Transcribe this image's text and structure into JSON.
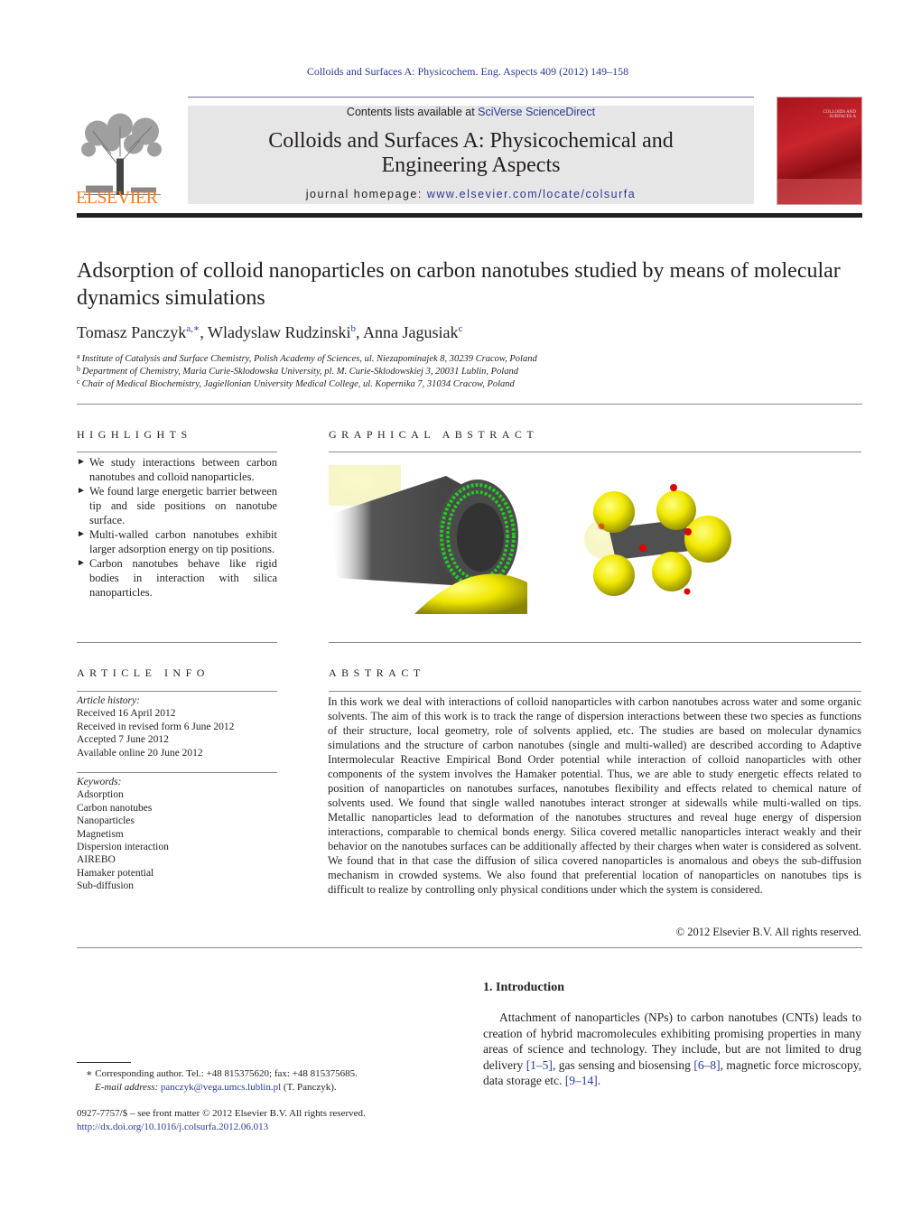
{
  "header": {
    "running_head": "Colloids and Surfaces A: Physicochem. Eng. Aspects 409 (2012) 149–158",
    "contents_prefix": "Contents lists available at ",
    "contents_link": "SciVerse ScienceDirect",
    "journal_title_line1": "Colloids and Surfaces A: Physicochemical and",
    "journal_title_line2": "Engineering Aspects",
    "homepage_prefix": "journal homepage: ",
    "homepage_link": "www.elsevier.com/locate/colsurfa",
    "publisher_logo_text": "ELSEVIER",
    "cover_title": "COLLOIDS AND SURFACES A"
  },
  "article": {
    "title": "Adsorption of colloid nanoparticles on carbon nanotubes studied by means of molecular dynamics simulations",
    "authors": [
      {
        "name": "Tomasz Panczyk",
        "sup": "a,∗"
      },
      {
        "name": "Wladyslaw Rudzinski",
        "sup": "b"
      },
      {
        "name": "Anna Jagusiak",
        "sup": "c"
      }
    ],
    "affiliations": [
      {
        "mark": "a",
        "text": "Institute of Catalysis and Surface Chemistry, Polish Academy of Sciences, ul. Niezapominajek 8, 30239 Cracow, Poland"
      },
      {
        "mark": "b",
        "text": "Department of Chemistry, Maria Curie-Sklodowska University, pl. M. Curie-Sklodowskiej 3, 20031 Lublin, Poland"
      },
      {
        "mark": "c",
        "text": "Chair of Medical Biochemistry, Jagiellonian University Medical College, ul. Kopernika 7, 31034 Cracow, Poland"
      }
    ]
  },
  "highlights": {
    "heading": "HIGHLIGHTS",
    "items": [
      "We study interactions between carbon nanotubes and colloid nanoparticles.",
      "We found large energetic barrier between tip and side positions on nanotube surface.",
      "Multi-walled carbon nanotubes exhibit larger adsorption energy on tip positions.",
      "Carbon nanotubes behave like rigid bodies in interaction with silica nanoparticles."
    ]
  },
  "graphical_abstract": {
    "heading": "GRAPHICAL ABSTRACT"
  },
  "article_info": {
    "heading": "ARTICLE INFO",
    "history_label": "Article history:",
    "history": [
      "Received 16 April 2012",
      "Received in revised form 6 June 2012",
      "Accepted 7 June 2012",
      "Available online 20 June 2012"
    ],
    "keywords_label": "Keywords:",
    "keywords": [
      "Adsorption",
      "Carbon nanotubes",
      "Nanoparticles",
      "Magnetism",
      "Dispersion interaction",
      "AIREBO",
      "Hamaker potential",
      "Sub-diffusion"
    ]
  },
  "abstract": {
    "heading": "ABSTRACT",
    "text": "In this work we deal with interactions of colloid nanoparticles with carbon nanotubes across water and some organic solvents. The aim of this work is to track the range of dispersion interactions between these two species as functions of their structure, local geometry, role of solvents applied, etc. The studies are based on molecular dynamics simulations and the structure of carbon nanotubes (single and multi-walled) are described according to Adaptive Intermolecular Reactive Empirical Bond Order potential while interaction of colloid nanoparticles with other components of the system involves the Hamaker potential. Thus, we are able to study energetic effects related to position of nanoparticles on nanotubes surfaces, nanotubes flexibility and effects related to chemical nature of solvents used. We found that single walled nanotubes interact stronger at sidewalls while multi-walled on tips. Metallic nanoparticles lead to deformation of the nanotubes structures and reveal huge energy of dispersion interactions, comparable to chemical bonds energy. Silica covered metallic nanoparticles interact weakly and their behavior on the nanotubes surfaces can be additionally affected by their charges when water is considered as solvent. We found that in that case the diffusion of silica covered nanoparticles is anomalous and obeys the sub-diffusion mechanism in crowded systems. We also found that preferential location of nanoparticles on nanotubes tips is difficult to realize by controlling only physical conditions under which the system is considered.",
    "copyright": "© 2012 Elsevier B.V. All rights reserved."
  },
  "introduction": {
    "heading": "1.  Introduction",
    "parts": [
      {
        "t": "Attachment of nanoparticles (NPs) to carbon nanotubes (CNTs) leads to creation of hybrid macromolecules exhibiting promising properties in many areas of science and technology. They include, but are not limited to drug delivery ",
        "link": false
      },
      {
        "t": "[1–5]",
        "link": true
      },
      {
        "t": ", gas sensing and biosensing ",
        "link": false
      },
      {
        "t": "[6–8]",
        "link": true
      },
      {
        "t": ", magnetic force microscopy, data storage etc. ",
        "link": false
      },
      {
        "t": "[9–14]",
        "link": true
      },
      {
        "t": ".",
        "link": false
      }
    ]
  },
  "footnote": {
    "mark": "∗",
    "text": "Corresponding author. Tel.: +48 815375620; fax: +48 815375685.",
    "email_label": "E-mail address: ",
    "email": "panczyk@vega.umcs.lublin.pl",
    "email_suffix": " (T. Panczyk)."
  },
  "footer": {
    "issn": "0927-7757/$ – see front matter © 2012 Elsevier B.V. All rights reserved.",
    "doi": "http://dx.doi.org/10.1016/j.colsurfa.2012.06.013"
  },
  "colors": {
    "link": "#2b3a93",
    "elsevier_orange": "#f47b20",
    "cover_red": "#b3141c",
    "banner_gray": "#e6e6e6"
  }
}
